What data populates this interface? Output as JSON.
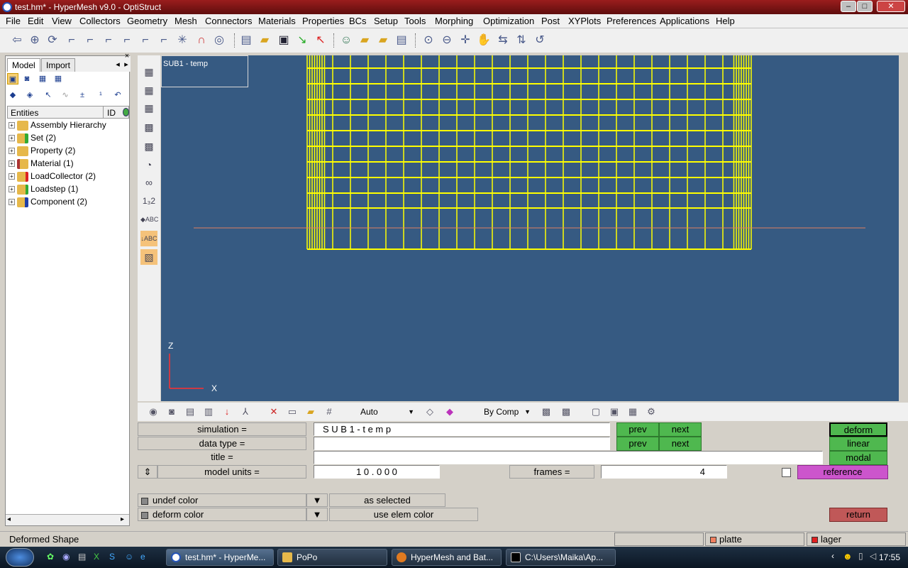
{
  "window": {
    "title": "test.hm* - HyperMesh v9.0 - OptiStruct",
    "min": "–",
    "max": "□",
    "close": "✕"
  },
  "menu": [
    "File",
    "Edit",
    "View",
    "Collectors",
    "Geometry",
    "Mesh",
    "Connectors",
    "Materials",
    "Properties",
    "BCs",
    "Setup",
    "Tools",
    "Morphing",
    "Optimization",
    "Post",
    "XYPlots",
    "Preferences",
    "Applications",
    "Help"
  ],
  "browser": {
    "tabs": [
      "Model",
      "Import"
    ],
    "columns": {
      "entities": "Entities",
      "id": "ID"
    },
    "tree": [
      "Assembly Hierarchy",
      "Set (2)",
      "Property (2)",
      "Material (1)",
      "LoadCollector (2)",
      "Loadstep (1)",
      "Component (2)"
    ]
  },
  "viewport": {
    "subcase_label": "SUB1 - temp",
    "axis_z": "Z",
    "axis_x": "X",
    "background": "#365a82",
    "mesh_color": "#ffff00"
  },
  "bottom_toolbar": {
    "display_mode": "Auto",
    "color_mode": "By Comp"
  },
  "panel": {
    "simulation_label": "simulation     =",
    "simulation_value": "S U B 1    -    t e m p",
    "datatype_label": "data type     =",
    "datatype_value": "",
    "title_label": "title        =",
    "title_value": "",
    "units_label": "model units  =",
    "units_value": "1 0 . 0 0 0",
    "frames_label": "frames =",
    "frames_value": "4",
    "prev": "prev",
    "next": "next",
    "deform": "deform",
    "linear": "linear",
    "modal": "modal",
    "reference": "reference",
    "undef_color": "undef color",
    "deform_color": "deform color",
    "as_selected": "as selected",
    "use_elem_color": "use elem color",
    "return": "return"
  },
  "status": {
    "text": "Deformed Shape",
    "comp1": "platte",
    "comp2": "lager",
    "comp1_color": "#f08060",
    "comp2_color": "#e02020"
  },
  "taskbar": {
    "items": [
      "test.hm* - HyperMe...",
      "PoPo",
      "HyperMesh and Bat...",
      "C:\\Users\\Maika\\Ap..."
    ],
    "clock": "17:55"
  }
}
